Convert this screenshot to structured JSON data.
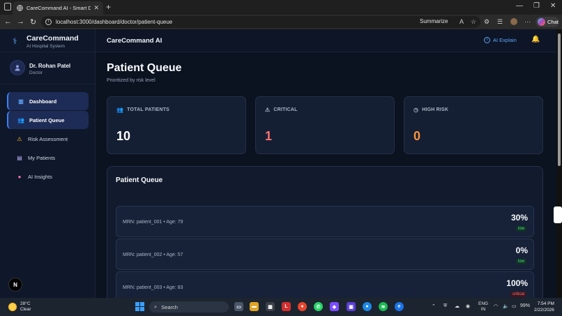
{
  "browser": {
    "tab_title": "CareCommand AI - Smart Digital I",
    "url": "localhost:3000/dashboard/doctor/patient-queue",
    "summarize_label": "Summarize",
    "chat_label": "Chat"
  },
  "sidebar": {
    "brand_name": "CareCommand",
    "brand_sub": "AI Hospital System",
    "user_name": "Dr. Rohan Patel",
    "user_role": "Doctor",
    "items": [
      {
        "label": "Dashboard",
        "icon": "chart-icon",
        "active": true
      },
      {
        "label": "Patient Queue",
        "icon": "users-icon",
        "active": true
      },
      {
        "label": "Risk Assessment",
        "icon": "warning-icon",
        "active": false
      },
      {
        "label": "My Patients",
        "icon": "clipboard-icon",
        "active": false
      },
      {
        "label": "AI Insights",
        "icon": "brain-icon",
        "active": false
      }
    ],
    "badge": "N"
  },
  "topbar": {
    "title": "CareCommand AI",
    "ai_explain": "AI Explain"
  },
  "page": {
    "title": "Patient Queue",
    "subtitle": "Prioritized by risk level"
  },
  "stats": [
    {
      "label": "TOTAL PATIENTS",
      "value": "10",
      "color": "#ffffff"
    },
    {
      "label": "CRITICAL",
      "value": "1",
      "color": "#f87171"
    },
    {
      "label": "HIGH RISK",
      "value": "0",
      "color": "#fb923c"
    }
  ],
  "queue": {
    "title": "Patient Queue",
    "rows": [
      {
        "mrn": "MRN: patient_001 • Age: 79",
        "pct": "30%",
        "level": "low"
      },
      {
        "mrn": "MRN: patient_002 • Age: 57",
        "pct": "0%",
        "level": "low"
      },
      {
        "mrn": "MRN: patient_003 • Age: 83",
        "pct": "100%",
        "level": "critical"
      }
    ]
  },
  "taskbar": {
    "temp": "28°C",
    "weather": "Clear",
    "search_placeholder": "Search",
    "lang_line1": "ENG",
    "lang_line2": "IN",
    "battery": "99%",
    "time": "7:54 PM",
    "date": "2/22/2026"
  }
}
